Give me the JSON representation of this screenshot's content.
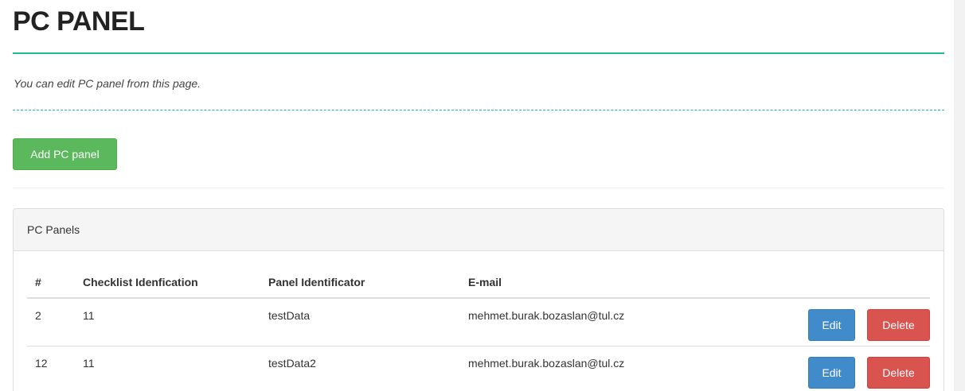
{
  "page": {
    "title": "PC PANEL",
    "description": "You can edit PC panel from this page.",
    "add_button_label": "Add PC panel"
  },
  "panel": {
    "heading": "PC Panels",
    "columns": [
      "#",
      "Checklist Idenfication",
      "Panel Identificator",
      "E-mail"
    ],
    "rows": [
      {
        "num": "2",
        "checklist": "11",
        "panel": "testData",
        "email": "mehmet.burak.bozaslan@tul.cz",
        "edit_label": "Edit",
        "delete_label": "Delete"
      },
      {
        "num": "12",
        "checklist": "11",
        "panel": "testData2",
        "email": "mehmet.burak.bozaslan@tul.cz",
        "edit_label": "Edit",
        "delete_label": "Delete"
      }
    ]
  },
  "colors": {
    "accent": "#1abc9c",
    "success": "#5cb85c",
    "primary": "#428bca",
    "danger": "#d9534f"
  }
}
